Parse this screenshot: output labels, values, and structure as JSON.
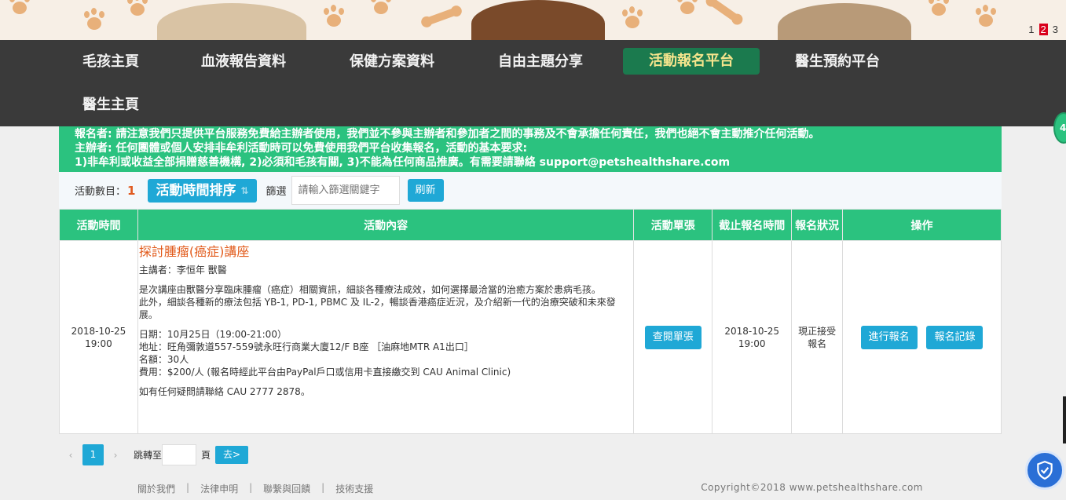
{
  "banner": {
    "pages": [
      "1",
      "2",
      "3"
    ],
    "active_page": "2"
  },
  "nav": {
    "items": [
      {
        "label": "毛孩主頁"
      },
      {
        "label": "血液報告資料"
      },
      {
        "label": "保健方案資料"
      },
      {
        "label": "自由主題分享"
      },
      {
        "label": "活動報名平台"
      },
      {
        "label": "醫生預約平台"
      },
      {
        "label": "醫生主頁"
      }
    ],
    "active": "活動報名平台"
  },
  "notice": {
    "line1": "報名者: 請注意我們只提供平台服務免費給主辦者使用，我們並不參與主辦者和參加者之間的事務及不會承擔任何責任，我們也絕不會主動推介任何活動。",
    "line2": "主辦者: 任何團體或個人安排非牟利活動時可以免費使用我們平台收集報名，活動的基本要求:",
    "line3": "1)非牟利或收益全部捐贈慈善機構, 2)必須和毛孩有關, 3)不能為任何商品推廣。有需要請聯絡 support@petshealthshare.com",
    "side_badge": "4"
  },
  "toolbar": {
    "count_label": "活動數目：",
    "count_value": "1",
    "sort_label": "活動時間排序",
    "filter_label": "篩選",
    "filter_placeholder": "請輸入篩選關鍵字",
    "refresh_label": "刷新"
  },
  "table": {
    "headers": [
      "活動時間",
      "活動內容",
      "活動單張",
      "截止報名時間",
      "報名狀況",
      "操作"
    ],
    "rows": [
      {
        "time_date": "2018-10-25",
        "time_hour": "19:00",
        "title": "探討腫瘤(癌症)講座",
        "speaker": "主講者：李恒年 獸醫",
        "desc1": "是次講座由獸醫分享臨床腫瘤（癌症）相關資訊，細談各種療法成效，如何選擇最洽當的治癒方案於患病毛孩。",
        "desc2": "此外，細談各種新的療法包括 YB-1, PD-1, PBMC 及 IL-2，暢談香港癌症近況，及介紹新一代的治療突破和未來發展。",
        "date_line": "日期：10月25日（19:00-21:00）",
        "address_line": "地址：旺角彌敦道557-559號永旺行商業大廈12/F B座 ［油麻地MTR A1出口］",
        "quota_line": "名額：30人",
        "fee_line": "費用：$200/人 (報名時經此平台由PayPal戶口或信用卡直接繳交到 CAU Animal Clinic)",
        "contact_line": "如有任何疑問請聯絡 CAU 2777 2878。",
        "leaflet_btn": "查閱單張",
        "deadline_date": "2018-10-25",
        "deadline_hour": "19:00",
        "status_line1": "現正接受",
        "status_line2": "報名",
        "register_btn": "進行報名",
        "records_btn": "報名記錄"
      }
    ]
  },
  "pagination": {
    "prev": "‹",
    "current": "1",
    "next": "›",
    "goto_label": "跳轉至",
    "page_unit": "頁",
    "go_label": "去>"
  },
  "footer": {
    "links": [
      "關於我們",
      "法律申明",
      "聯繫與回饋",
      "技術支援"
    ],
    "separator": "|",
    "copyright": "Copyright©2018 www.petshealthshare.com"
  },
  "colors": {
    "green": "#2bc27f",
    "nav_bg": "#3a3a3a",
    "active_nav": "#1b7a4e",
    "blue_button": "#1fa8d6",
    "title_orange": "#e25a1a"
  }
}
